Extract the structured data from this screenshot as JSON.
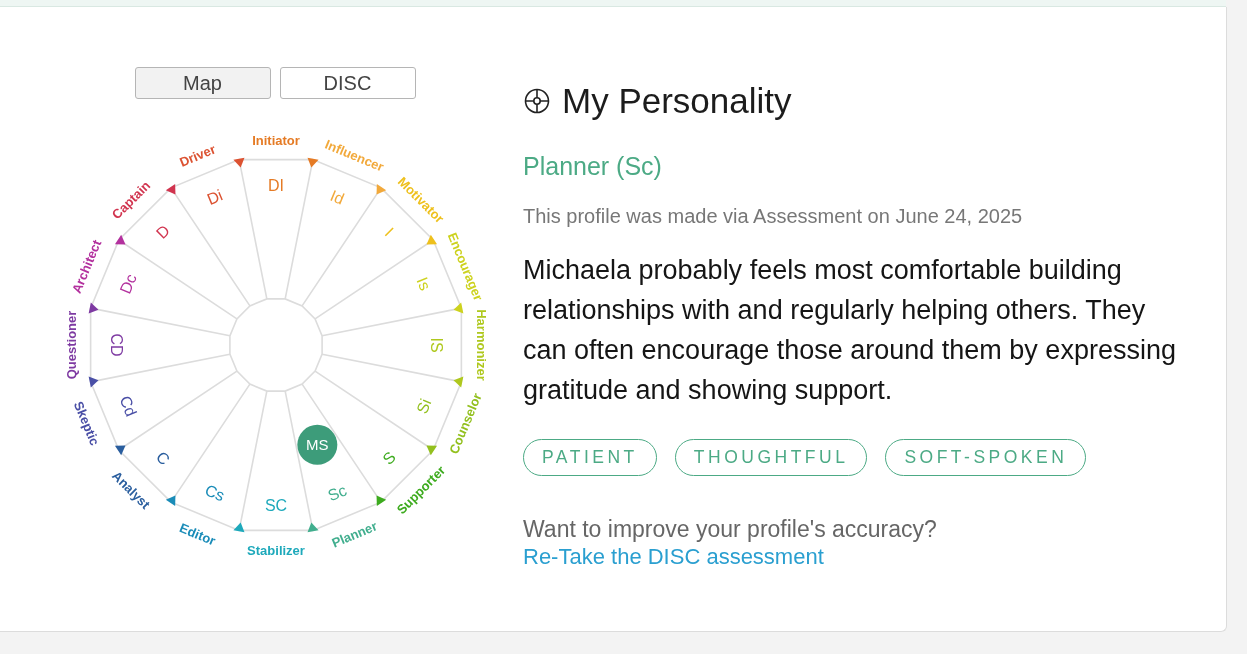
{
  "view_toggle": [
    {
      "label": "Map",
      "selected": true
    },
    {
      "label": "DISC",
      "selected": false
    }
  ],
  "wheel": {
    "marker": "MS",
    "segments": [
      {
        "code": "DI",
        "label": "Initiator",
        "color": "#e57b25",
        "selected": false
      },
      {
        "code": "Id",
        "label": "Influencer",
        "color": "#f2a93b",
        "selected": false
      },
      {
        "code": "I",
        "label": "Motivator",
        "color": "#eec01c",
        "selected": false
      },
      {
        "code": "Is",
        "label": "Encourager",
        "color": "#cdd21e",
        "selected": false
      },
      {
        "code": "IS",
        "label": "Harmonizer",
        "color": "#afc81e",
        "selected": false
      },
      {
        "code": "Si",
        "label": "Counselor",
        "color": "#93c01e",
        "selected": false
      },
      {
        "code": "S",
        "label": "Supporter",
        "color": "#3dab1e",
        "selected": false
      },
      {
        "code": "Sc",
        "label": "Planner",
        "color": "#41ae8e",
        "selected": true
      },
      {
        "code": "SC",
        "label": "Stabilizer",
        "color": "#1ea9bb",
        "selected": false
      },
      {
        "code": "Cs",
        "label": "Editor",
        "color": "#1a8cb8",
        "selected": false
      },
      {
        "code": "C",
        "label": "Analyst",
        "color": "#2a5e9e",
        "selected": false
      },
      {
        "code": "Cd",
        "label": "Skeptic",
        "color": "#4a4fa6",
        "selected": false
      },
      {
        "code": "CD",
        "label": "Questioner",
        "color": "#7e3aa2",
        "selected": false
      },
      {
        "code": "Dc",
        "label": "Architect",
        "color": "#b3319e",
        "selected": false
      },
      {
        "code": "D",
        "label": "Captain",
        "color": "#d1344f",
        "selected": false
      },
      {
        "code": "Di",
        "label": "Driver",
        "color": "#dc5231",
        "selected": false
      }
    ]
  },
  "profile": {
    "title": "My Personality",
    "type": "Planner (Sc)",
    "source": "This profile was made via Assessment on June 24, 2025",
    "description": "Michaela probably feels most comfortable building relationships with and regularly helping others. They can often encourage those around them by expressing gratitude and showing support.",
    "traits": [
      "PATIENT",
      "THOUGHTFUL",
      "SOFT-SPOKEN"
    ],
    "prompt": "Want to improve your profile's accuracy?",
    "link": "Re-Take the DISC assessment"
  }
}
